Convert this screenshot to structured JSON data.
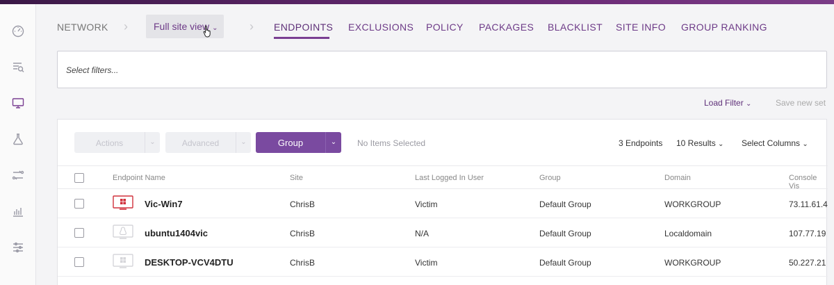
{
  "breadcrumb": {
    "root": "NETWORK",
    "site_view": "Full site view"
  },
  "tabs": [
    {
      "label": "ENDPOINTS",
      "active": true
    },
    {
      "label": "EXCLUSIONS"
    },
    {
      "label": "POLICY"
    },
    {
      "label": "PACKAGES"
    },
    {
      "label": "BLACKLIST"
    },
    {
      "label": "SITE INFO"
    },
    {
      "label": "GROUP RANKING"
    }
  ],
  "filter": {
    "placeholder": "Select filters..."
  },
  "filter_actions": {
    "load": "Load Filter",
    "save": "Save new set"
  },
  "toolbar": {
    "actions": "Actions",
    "advanced": "Advanced",
    "group": "Group",
    "selection": "No Items Selected",
    "count": "3 Endpoints",
    "results": "10 Results",
    "columns": "Select Columns"
  },
  "table": {
    "headers": [
      "Endpoint Name",
      "Site",
      "Last Logged In User",
      "Group",
      "Domain",
      "Console Vis"
    ],
    "rows": [
      {
        "name": "Vic-Win7",
        "os": "windows",
        "status": "alert",
        "site": "ChrisB",
        "user": "Victim",
        "group": "Default Group",
        "domain": "WORKGROUP",
        "console": "73.11.61.4"
      },
      {
        "name": "ubuntu1404vic",
        "os": "linux",
        "status": "ok",
        "site": "ChrisB",
        "user": "N/A",
        "group": "Default Group",
        "domain": "Localdomain",
        "console": "107.77.19"
      },
      {
        "name": "DESKTOP-VCV4DTU",
        "os": "windows",
        "status": "ok",
        "site": "ChrisB",
        "user": "Victim",
        "group": "Default Group",
        "domain": "WORKGROUP",
        "console": "50.227.21"
      }
    ]
  },
  "sidebar_icons": [
    "dashboard-icon",
    "search-list-icon",
    "monitor-icon",
    "flask-icon",
    "routes-icon",
    "reports-icon",
    "settings-sliders-icon"
  ],
  "colors": {
    "accent": "#7a3f92",
    "alert": "#d0313c",
    "group_button": "#7a4aa0"
  }
}
